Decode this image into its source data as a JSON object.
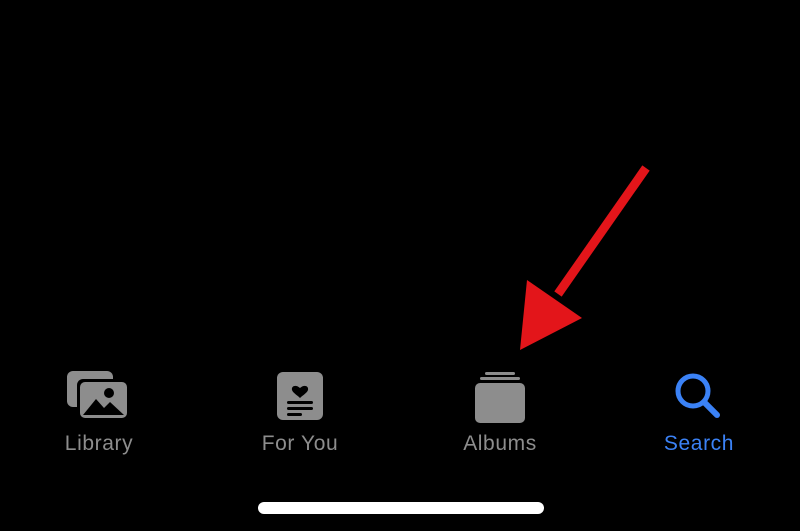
{
  "tab_bar": {
    "tabs": [
      {
        "label": "Library",
        "icon": "photo-stack-icon",
        "active": false
      },
      {
        "label": "For You",
        "icon": "for-you-card-icon",
        "active": false
      },
      {
        "label": "Albums",
        "icon": "albums-stack-icon",
        "active": false
      },
      {
        "label": "Search",
        "icon": "magnifying-glass-icon",
        "active": true
      }
    ]
  },
  "annotation": {
    "type": "arrow",
    "color": "#e3151a",
    "points_to": "Albums"
  },
  "colors": {
    "background": "#000000",
    "inactive": "#8d8d8d",
    "active": "#3b82f6",
    "home_indicator": "#ffffff"
  }
}
